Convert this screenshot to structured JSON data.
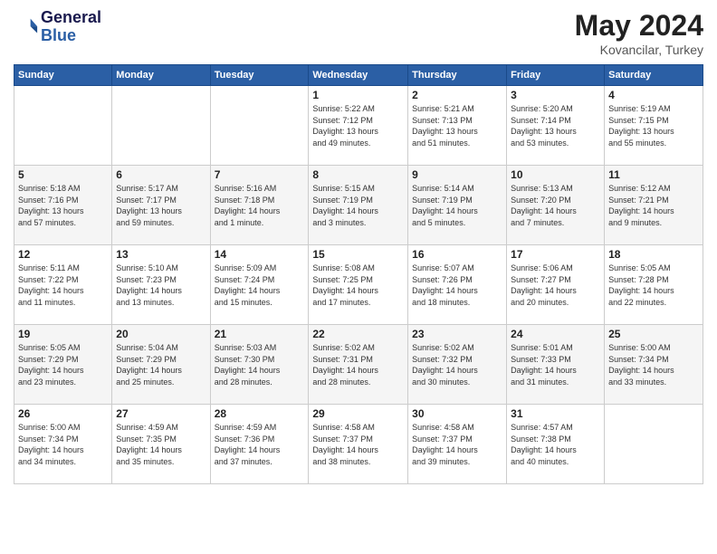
{
  "logo": {
    "line1": "General",
    "line2": "Blue"
  },
  "title": "May 2024",
  "subtitle": "Kovancilar, Turkey",
  "days_header": [
    "Sunday",
    "Monday",
    "Tuesday",
    "Wednesday",
    "Thursday",
    "Friday",
    "Saturday"
  ],
  "weeks": [
    [
      {
        "day": "",
        "info": ""
      },
      {
        "day": "",
        "info": ""
      },
      {
        "day": "",
        "info": ""
      },
      {
        "day": "1",
        "info": "Sunrise: 5:22 AM\nSunset: 7:12 PM\nDaylight: 13 hours\nand 49 minutes."
      },
      {
        "day": "2",
        "info": "Sunrise: 5:21 AM\nSunset: 7:13 PM\nDaylight: 13 hours\nand 51 minutes."
      },
      {
        "day": "3",
        "info": "Sunrise: 5:20 AM\nSunset: 7:14 PM\nDaylight: 13 hours\nand 53 minutes."
      },
      {
        "day": "4",
        "info": "Sunrise: 5:19 AM\nSunset: 7:15 PM\nDaylight: 13 hours\nand 55 minutes."
      }
    ],
    [
      {
        "day": "5",
        "info": "Sunrise: 5:18 AM\nSunset: 7:16 PM\nDaylight: 13 hours\nand 57 minutes."
      },
      {
        "day": "6",
        "info": "Sunrise: 5:17 AM\nSunset: 7:17 PM\nDaylight: 13 hours\nand 59 minutes."
      },
      {
        "day": "7",
        "info": "Sunrise: 5:16 AM\nSunset: 7:18 PM\nDaylight: 14 hours\nand 1 minute."
      },
      {
        "day": "8",
        "info": "Sunrise: 5:15 AM\nSunset: 7:19 PM\nDaylight: 14 hours\nand 3 minutes."
      },
      {
        "day": "9",
        "info": "Sunrise: 5:14 AM\nSunset: 7:19 PM\nDaylight: 14 hours\nand 5 minutes."
      },
      {
        "day": "10",
        "info": "Sunrise: 5:13 AM\nSunset: 7:20 PM\nDaylight: 14 hours\nand 7 minutes."
      },
      {
        "day": "11",
        "info": "Sunrise: 5:12 AM\nSunset: 7:21 PM\nDaylight: 14 hours\nand 9 minutes."
      }
    ],
    [
      {
        "day": "12",
        "info": "Sunrise: 5:11 AM\nSunset: 7:22 PM\nDaylight: 14 hours\nand 11 minutes."
      },
      {
        "day": "13",
        "info": "Sunrise: 5:10 AM\nSunset: 7:23 PM\nDaylight: 14 hours\nand 13 minutes."
      },
      {
        "day": "14",
        "info": "Sunrise: 5:09 AM\nSunset: 7:24 PM\nDaylight: 14 hours\nand 15 minutes."
      },
      {
        "day": "15",
        "info": "Sunrise: 5:08 AM\nSunset: 7:25 PM\nDaylight: 14 hours\nand 17 minutes."
      },
      {
        "day": "16",
        "info": "Sunrise: 5:07 AM\nSunset: 7:26 PM\nDaylight: 14 hours\nand 18 minutes."
      },
      {
        "day": "17",
        "info": "Sunrise: 5:06 AM\nSunset: 7:27 PM\nDaylight: 14 hours\nand 20 minutes."
      },
      {
        "day": "18",
        "info": "Sunrise: 5:05 AM\nSunset: 7:28 PM\nDaylight: 14 hours\nand 22 minutes."
      }
    ],
    [
      {
        "day": "19",
        "info": "Sunrise: 5:05 AM\nSunset: 7:29 PM\nDaylight: 14 hours\nand 23 minutes."
      },
      {
        "day": "20",
        "info": "Sunrise: 5:04 AM\nSunset: 7:29 PM\nDaylight: 14 hours\nand 25 minutes."
      },
      {
        "day": "21",
        "info": "Sunrise: 5:03 AM\nSunset: 7:30 PM\nDaylight: 14 hours\nand 28 minutes."
      },
      {
        "day": "22",
        "info": "Sunrise: 5:02 AM\nSunset: 7:31 PM\nDaylight: 14 hours\nand 28 minutes."
      },
      {
        "day": "23",
        "info": "Sunrise: 5:02 AM\nSunset: 7:32 PM\nDaylight: 14 hours\nand 30 minutes."
      },
      {
        "day": "24",
        "info": "Sunrise: 5:01 AM\nSunset: 7:33 PM\nDaylight: 14 hours\nand 31 minutes."
      },
      {
        "day": "25",
        "info": "Sunrise: 5:00 AM\nSunset: 7:34 PM\nDaylight: 14 hours\nand 33 minutes."
      }
    ],
    [
      {
        "day": "26",
        "info": "Sunrise: 5:00 AM\nSunset: 7:34 PM\nDaylight: 14 hours\nand 34 minutes."
      },
      {
        "day": "27",
        "info": "Sunrise: 4:59 AM\nSunset: 7:35 PM\nDaylight: 14 hours\nand 35 minutes."
      },
      {
        "day": "28",
        "info": "Sunrise: 4:59 AM\nSunset: 7:36 PM\nDaylight: 14 hours\nand 37 minutes."
      },
      {
        "day": "29",
        "info": "Sunrise: 4:58 AM\nSunset: 7:37 PM\nDaylight: 14 hours\nand 38 minutes."
      },
      {
        "day": "30",
        "info": "Sunrise: 4:58 AM\nSunset: 7:37 PM\nDaylight: 14 hours\nand 39 minutes."
      },
      {
        "day": "31",
        "info": "Sunrise: 4:57 AM\nSunset: 7:38 PM\nDaylight: 14 hours\nand 40 minutes."
      },
      {
        "day": "",
        "info": ""
      }
    ]
  ]
}
